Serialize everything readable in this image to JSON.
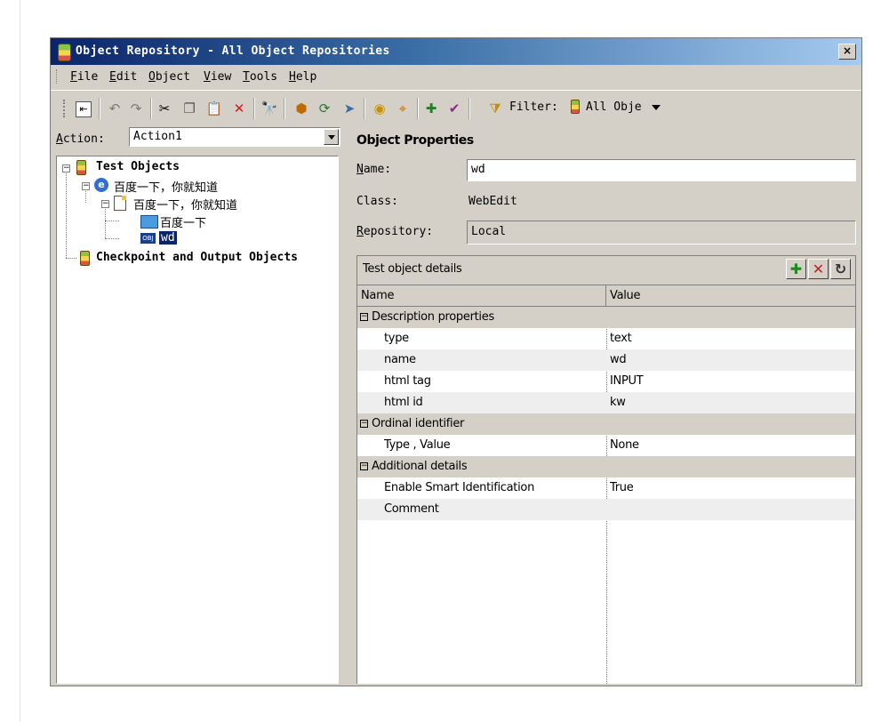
{
  "window": {
    "title": "Object Repository - All Object Repositories",
    "close": "×"
  },
  "menu": [
    {
      "label": "File",
      "key": "F",
      "rest": "ile"
    },
    {
      "label": "Edit",
      "key": "E",
      "rest": "dit"
    },
    {
      "label": "Object",
      "key": "O",
      "rest": "bject"
    },
    {
      "label": "View",
      "key": "V",
      "rest": "iew"
    },
    {
      "label": "Tools",
      "key": "T",
      "rest": "ools"
    },
    {
      "label": "Help",
      "key": "H",
      "rest": "elp"
    }
  ],
  "toolbar": {
    "filter_label": "Filter:",
    "filter_value": "All Obje",
    "icons": [
      "export-icon",
      "undo-icon",
      "redo-icon",
      "cut-icon",
      "copy-icon",
      "paste-icon",
      "delete-icon",
      "find-icon",
      "add-object-icon",
      "update-icon",
      "navigate-icon",
      "highlight-icon",
      "locate-icon",
      "add-checkpoint-icon",
      "checkpoint-icon",
      "filter-icon"
    ]
  },
  "action": {
    "label": "Action:",
    "key": "A",
    "rest": "ction:",
    "value": "Action1"
  },
  "tree": {
    "root": "Test Objects",
    "browser": "百度一下，你就知道",
    "page": "百度一下，你就知道",
    "button": "百度一下",
    "edit": "wd",
    "checkpoints": "Checkpoint and Output Objects"
  },
  "properties": {
    "title": "Object Properties",
    "name_label": "Name:",
    "name_value": "wd",
    "class_label": "Class:",
    "class_value": "WebEdit",
    "repo_label": "Repository:",
    "repo_value": "Local"
  },
  "details": {
    "title": "Test object details",
    "col_name": "Name",
    "col_value": "Value",
    "groups": {
      "description": "Description properties",
      "ordinal": "Ordinal identifier",
      "additional": "Additional details"
    },
    "rows": [
      {
        "name": "type",
        "value": "text"
      },
      {
        "name": "name",
        "value": "wd"
      },
      {
        "name": "html tag",
        "value": "INPUT"
      },
      {
        "name": "html id",
        "value": "kw"
      },
      {
        "name": "Type , Value",
        "value": "None"
      },
      {
        "name": "Enable Smart Identification",
        "value": "True"
      },
      {
        "name": "Comment",
        "value": ""
      }
    ]
  }
}
